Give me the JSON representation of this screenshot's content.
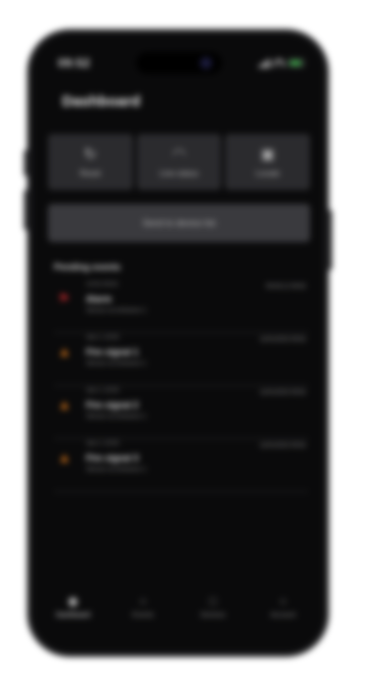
{
  "status_bar": {
    "time": "09:52"
  },
  "header": {
    "title": "Dashboard"
  },
  "quick_actions": [
    {
      "label": "Reset",
      "icon": "refresh-icon"
    },
    {
      "label": "Line status",
      "icon": "speedometer-icon"
    },
    {
      "label": "Locate",
      "icon": "locate-icon"
    }
  ],
  "primary_button": {
    "label": "Send to device list"
  },
  "section": {
    "title": "Pending events"
  },
  "alerts": [
    {
      "icon": "alert-icon",
      "color": "#c0282c",
      "meta": "10:52 09:54",
      "time": "09:45:12 09:52",
      "title": "Alarm",
      "subtitle": "Sensor at entrance 1"
    },
    {
      "icon": "fire-icon",
      "color": "#e07a1a",
      "meta": "Jan 2, 10:52",
      "time": "11/01/2023 09:52",
      "title": "Fire signal 1",
      "subtitle": "Sensor at entrance 1"
    },
    {
      "icon": "fire-icon",
      "color": "#e07a1a",
      "meta": "Jan 2, 10:52",
      "time": "11/01/2023 09:52",
      "title": "Fire signal 2",
      "subtitle": "Sensor at entrance 1"
    },
    {
      "icon": "fire-icon",
      "color": "#e07a1a",
      "meta": "Jan 2, 10:52",
      "time": "11/01/2023 09:52",
      "title": "Fire signal 3",
      "subtitle": "Sensor at entrance 1"
    }
  ],
  "tab_bar": [
    {
      "label": "Dashboard",
      "icon": "home-icon",
      "active": true
    },
    {
      "label": "Events",
      "icon": "bell-icon",
      "active": false
    },
    {
      "label": "Devices",
      "icon": "devices-icon",
      "active": false
    },
    {
      "label": "Account",
      "icon": "user-icon",
      "active": false
    }
  ]
}
